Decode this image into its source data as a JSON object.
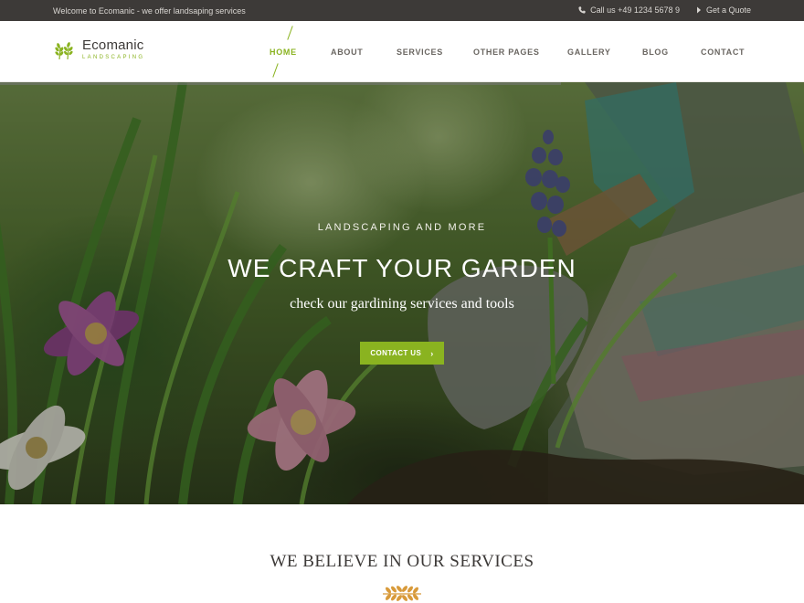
{
  "topbar": {
    "welcome": "Welcome to Ecomanic - we offer landsaping services",
    "phone": "Call us +49 1234 5678 9",
    "quote": "Get a Quote"
  },
  "brand": {
    "name": "Ecomanic",
    "tagline": "LANDSCAPING"
  },
  "nav": {
    "items": [
      "HOME",
      "ABOUT",
      "SERVICES",
      "OTHER PAGES",
      "GALLERY",
      "BLOG",
      "CONTACT"
    ],
    "active": "HOME"
  },
  "hero": {
    "kicker": "LANDSCAPING AND MORE",
    "title": "WE CRAFT YOUR GARDEN",
    "subtitle": "check our gardining services and tools",
    "cta": "CONTACT US"
  },
  "section": {
    "title": "WE BELIEVE IN OUR SERVICES"
  },
  "colors": {
    "accent": "#8ab320",
    "topbar": "#3d3a38",
    "text": "#3d3a38"
  },
  "icons": [
    "phone-icon",
    "caret-right-icon",
    "wheat-logo-icon",
    "chevron-right-icon",
    "wheat-divider-icon"
  ]
}
